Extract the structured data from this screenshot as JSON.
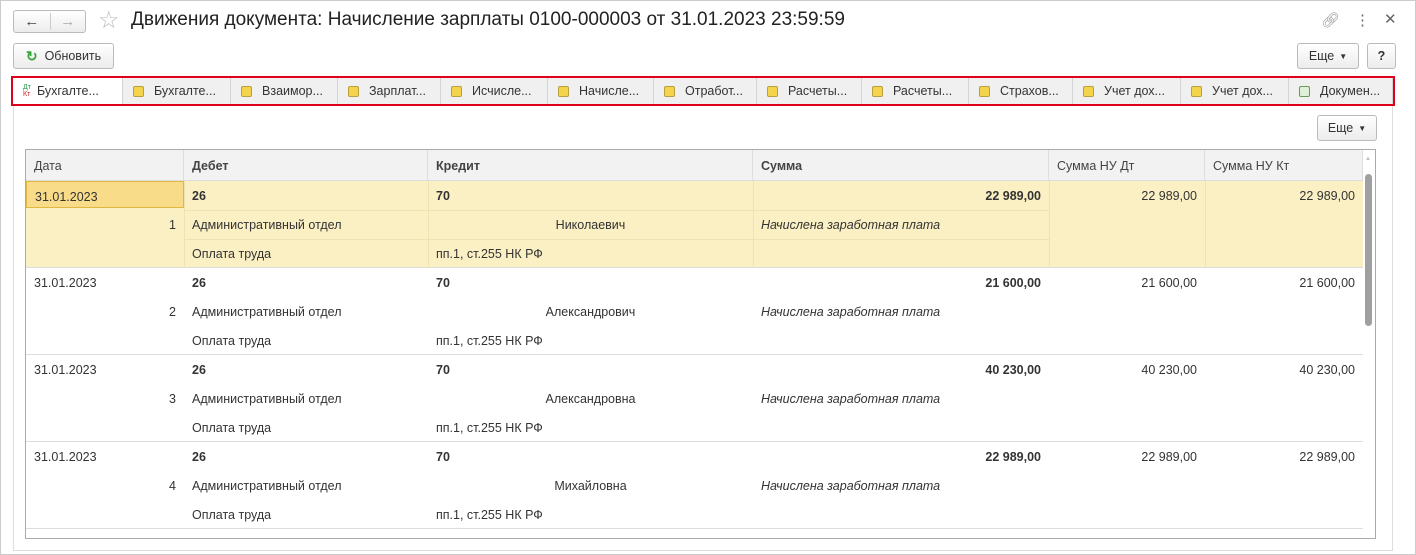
{
  "window": {
    "title": "Движения документа: Начисление зарплаты 0100-000003 от 31.01.2023 23:59:59"
  },
  "toolbar": {
    "refresh_label": "Обновить",
    "more_label": "Еще",
    "help_label": "?"
  },
  "tabs": [
    "Бухгалте...",
    "Бухгалте...",
    "Взаимор...",
    "Зарплат...",
    "Исчисле...",
    "Начисле...",
    "Отработ...",
    "Расчеты...",
    "Расчеты...",
    "Страхов...",
    "Учет дох...",
    "Учет дох...",
    "Докумен..."
  ],
  "grid": {
    "more_label": "Еще",
    "columns": [
      "Дата",
      "Дебет",
      "Кредит",
      "Сумма",
      "Сумма НУ Дт",
      "Сумма НУ Кт"
    ],
    "rows": [
      {
        "date": "31.01.2023",
        "num": "1",
        "debit": "26",
        "debit_sub1": "Административный отдел",
        "debit_sub2": "Оплата труда",
        "credit": "70",
        "credit_sub1": "Николаевич",
        "credit_sub2": "пп.1, ст.255 НК РФ",
        "sum": "22 989,00",
        "content": "Начислена заработная плата",
        "nu_dt": "22 989,00",
        "nu_kt": "22 989,00"
      },
      {
        "date": "31.01.2023",
        "num": "2",
        "debit": "26",
        "debit_sub1": "Административный отдел",
        "debit_sub2": "Оплата труда",
        "credit": "70",
        "credit_sub1": "Александрович",
        "credit_sub2": "пп.1, ст.255 НК РФ",
        "sum": "21 600,00",
        "content": "Начислена заработная плата",
        "nu_dt": "21 600,00",
        "nu_kt": "21 600,00"
      },
      {
        "date": "31.01.2023",
        "num": "3",
        "debit": "26",
        "debit_sub1": "Административный отдел",
        "debit_sub2": "Оплата труда",
        "credit": "70",
        "credit_sub1": "Александровна",
        "credit_sub2": "пп.1, ст.255 НК РФ",
        "sum": "40 230,00",
        "content": "Начислена заработная плата",
        "nu_dt": "40 230,00",
        "nu_kt": "40 230,00"
      },
      {
        "date": "31.01.2023",
        "num": "4",
        "debit": "26",
        "debit_sub1": "Административный отдел",
        "debit_sub2": "Оплата труда",
        "credit": "70",
        "credit_sub1": "Михайловна",
        "credit_sub2": "пп.1, ст.255 НК РФ",
        "sum": "22 989,00",
        "content": "Начислена заработная плата",
        "nu_dt": "22 989,00",
        "nu_kt": "22 989,00"
      }
    ]
  },
  "colors": {
    "selected_row": "#fbefc4",
    "tab_border": "#e0001b",
    "refresh_icon": "#3aa23a"
  }
}
